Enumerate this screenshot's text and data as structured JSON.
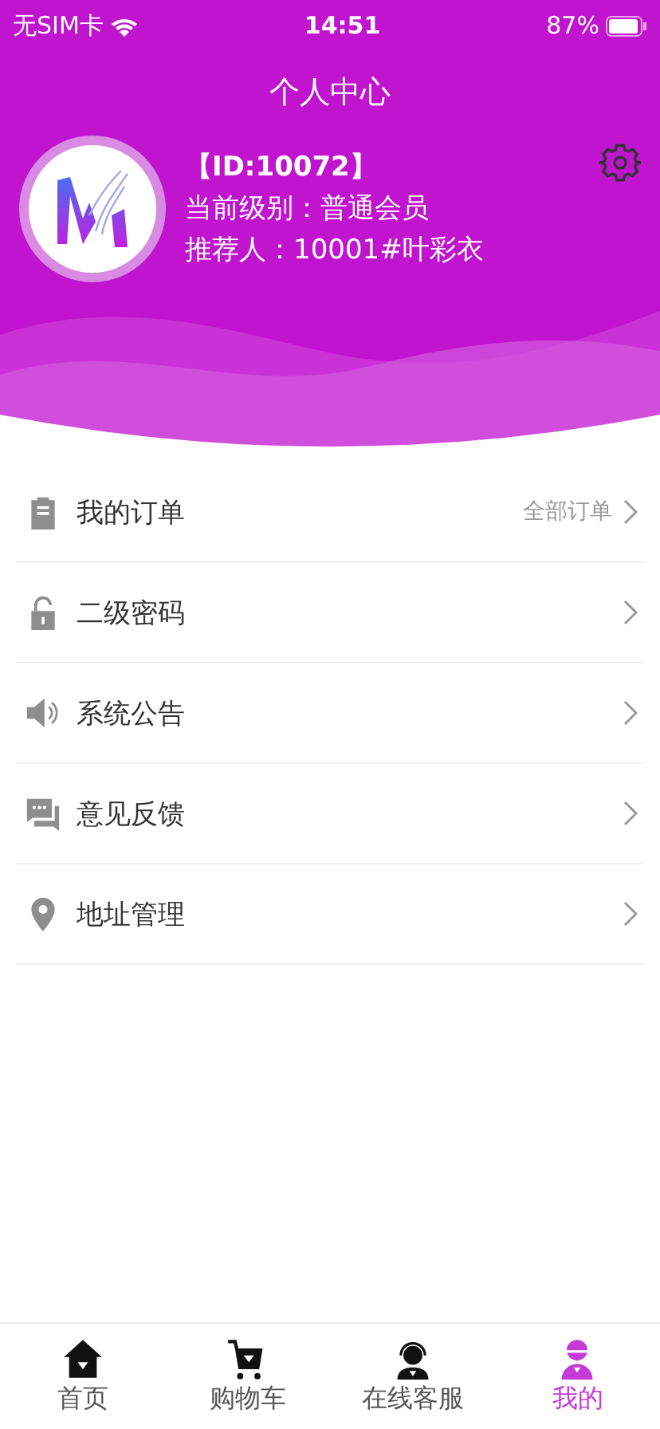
{
  "status_bar": {
    "carrier": "无SIM卡",
    "time": "14:51",
    "battery": "87%"
  },
  "header": {
    "title": "个人中心",
    "user_id": "【ID:10072】",
    "level": "当前级别：普通会员",
    "referrer": "推荐人：10001#叶彩衣"
  },
  "menu": [
    {
      "kind": "order",
      "label": "我的订单",
      "extra": "全部订单"
    },
    {
      "kind": "lock",
      "label": "二级密码"
    },
    {
      "kind": "speaker",
      "label": "系统公告"
    },
    {
      "kind": "chat",
      "label": "意见反馈"
    },
    {
      "kind": "pin",
      "label": "地址管理"
    }
  ],
  "tab_bar": [
    {
      "kind": "home",
      "label": "首页",
      "selected": false
    },
    {
      "kind": "cart",
      "label": "购物车",
      "selected": false
    },
    {
      "kind": "service",
      "label": "在线客服",
      "selected": false
    },
    {
      "kind": "me",
      "label": "我的",
      "selected": true
    }
  ]
}
